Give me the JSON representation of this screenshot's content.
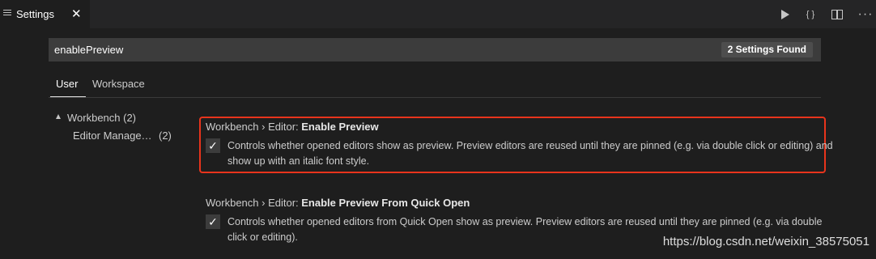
{
  "tab": {
    "title": "Settings",
    "close": "✕"
  },
  "actions": {
    "json_label": "{ }"
  },
  "search": {
    "value": "enablePreview",
    "result_count": "2 Settings Found"
  },
  "scopes": {
    "user": "User",
    "workspace": "Workspace"
  },
  "toc": {
    "workbench": "Workbench (2)",
    "editor": "Editor Manage…",
    "editor_count": "(2)"
  },
  "settings": [
    {
      "breadcrumb": "Workbench › Editor: ",
      "name": "Enable Preview",
      "checked": "✓",
      "description": "Controls whether opened editors show as preview. Preview editors are reused until they are pinned (e.g. via double click or editing) and show up with an italic font style."
    },
    {
      "breadcrumb": "Workbench › Editor: ",
      "name": "Enable Preview From Quick Open",
      "checked": "✓",
      "description": "Controls whether opened editors from Quick Open show as preview. Preview editors are reused until they are pinned (e.g. via double click or editing)."
    }
  ],
  "watermark": "https://blog.csdn.net/weixin_38575051"
}
